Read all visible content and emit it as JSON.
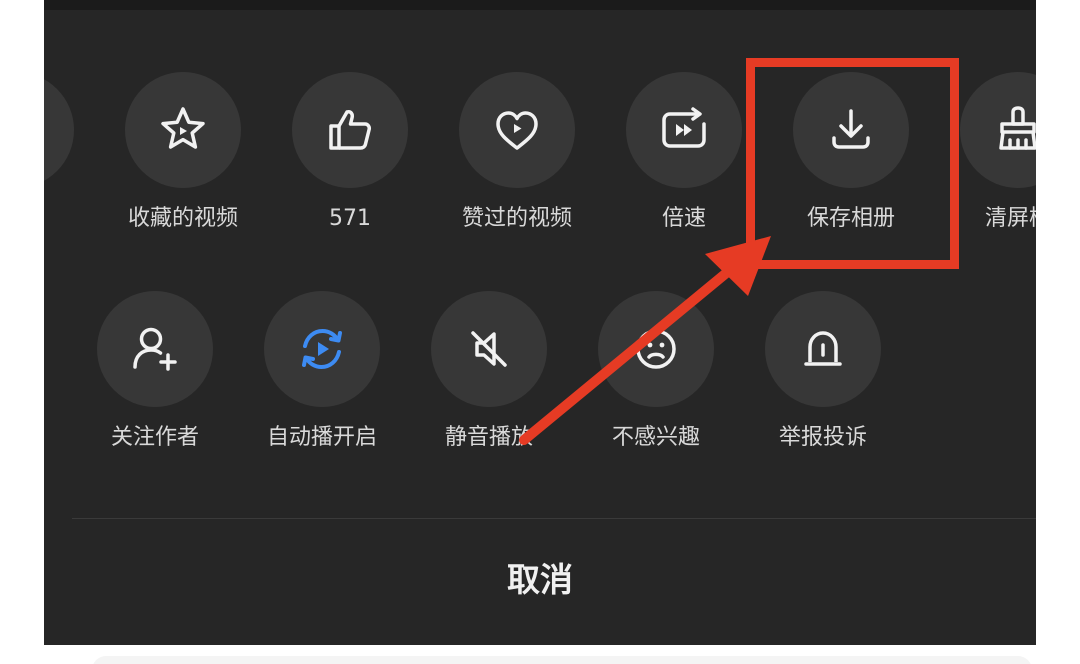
{
  "share_panel": {
    "row1": [
      {
        "label": "",
        "icon": "partial-icon"
      },
      {
        "label": "收藏的视频",
        "icon": "star-play-icon"
      },
      {
        "label": "571",
        "icon": "thumbs-up-icon"
      },
      {
        "label": "赞过的视频",
        "icon": "heart-play-icon"
      },
      {
        "label": "倍速",
        "icon": "speed-play-icon"
      },
      {
        "label": "保存相册",
        "icon": "download-icon"
      },
      {
        "label": "清屏模",
        "icon": "broom-icon"
      }
    ],
    "row2": [
      {
        "label": "关注作者",
        "icon": "add-user-icon"
      },
      {
        "label": "自动播开启",
        "icon": "autoplay-icon"
      },
      {
        "label": "静音播放",
        "icon": "mute-icon"
      },
      {
        "label": "不感兴趣",
        "icon": "sad-face-icon"
      },
      {
        "label": "举报投诉",
        "icon": "alarm-icon"
      }
    ],
    "cancel_label": "取消"
  },
  "colors": {
    "panel_background": "#262626",
    "icon_circle": "#373737",
    "icon_stroke": "#f2f2f2",
    "autoplay_accent": "#3d8bf2",
    "annotation_red": "#e63b24"
  }
}
